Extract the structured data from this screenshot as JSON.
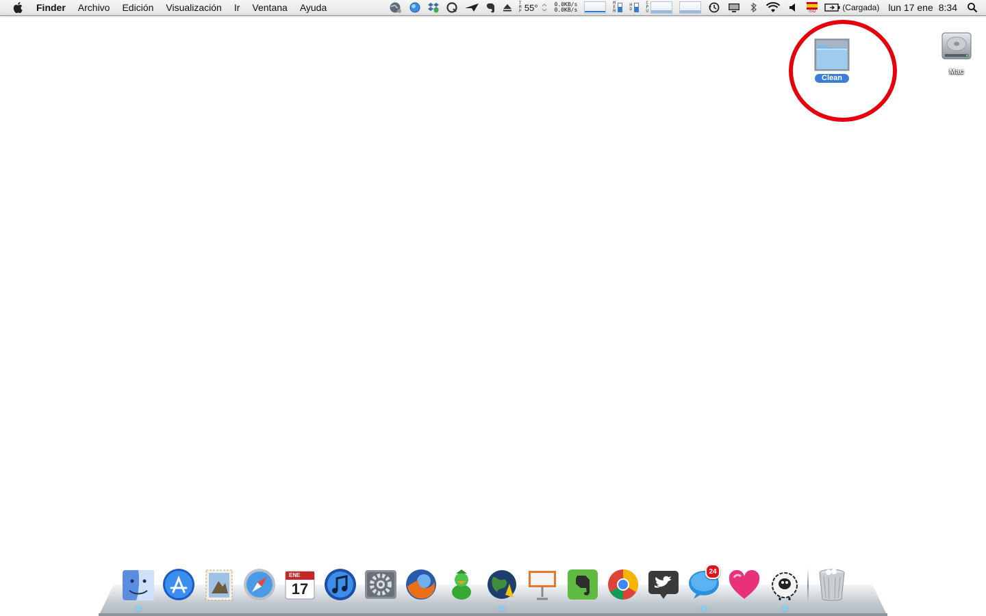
{
  "menubar": {
    "app_name": "Finder",
    "menus": [
      "Archivo",
      "Edición",
      "Visualización",
      "Ir",
      "Ventana",
      "Ayuda"
    ],
    "temperature": "55°",
    "temp_label": "TMP",
    "net_up": "0.0KB/s",
    "net_down": "0.0KB/s",
    "mem_label": "MEM",
    "hd_label": "HD",
    "cpu_label": "CPU",
    "input_source_label": "ISO",
    "battery_status": "(Cargada)",
    "date": "lun 17 ene",
    "time": "8:34"
  },
  "desktop": {
    "folder": {
      "label": "Clean",
      "icon": "folder-icon"
    },
    "drive": {
      "label": "Mac",
      "icon": "hard-drive-icon"
    }
  },
  "dock": {
    "calendar": {
      "month": "ENE",
      "day": "17"
    },
    "chat_badge": "24",
    "apps": [
      {
        "name": "finder",
        "running": true
      },
      {
        "name": "app-store",
        "running": false
      },
      {
        "name": "mail",
        "running": false
      },
      {
        "name": "safari",
        "running": false
      },
      {
        "name": "ical",
        "running": false
      },
      {
        "name": "itunes",
        "running": false
      },
      {
        "name": "system-preferences",
        "running": false
      },
      {
        "name": "firefox",
        "running": false
      },
      {
        "name": "adium",
        "running": false
      },
      {
        "name": "google-earth",
        "running": true
      },
      {
        "name": "keynote",
        "running": false
      },
      {
        "name": "evernote",
        "running": false
      },
      {
        "name": "chrome",
        "running": false
      },
      {
        "name": "twitter",
        "running": false
      },
      {
        "name": "chat-bubble",
        "running": true
      },
      {
        "name": "heart-app",
        "running": false
      },
      {
        "name": "sheep-app",
        "running": true
      },
      {
        "name": "trash",
        "running": false
      }
    ]
  },
  "colors": {
    "highlight_ring": "#e6000e",
    "selection": "#3c7ed6",
    "running_indicator": "#7fd3ff"
  }
}
